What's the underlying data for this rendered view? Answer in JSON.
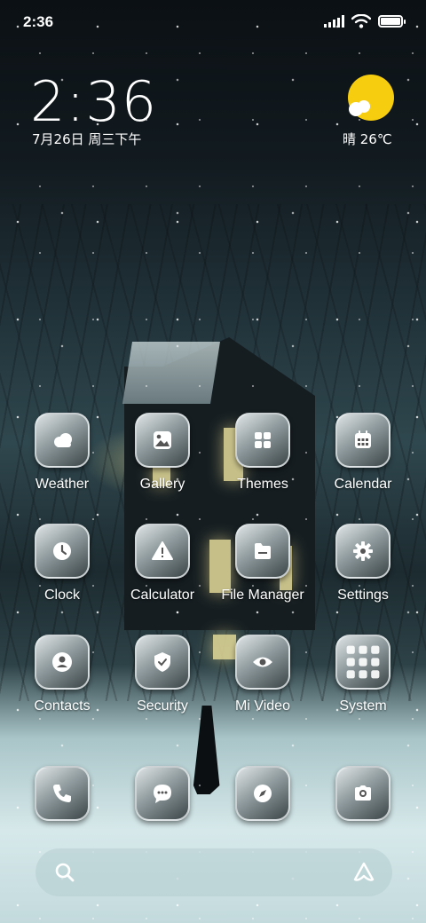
{
  "status_bar": {
    "time": "2:36",
    "icons": [
      "signal-icon",
      "wifi-icon",
      "battery-icon"
    ]
  },
  "clock_widget": {
    "time": "2:36",
    "date": "7月26日 周三下午"
  },
  "weather_widget": {
    "icon": "sun-cloud-icon",
    "text": "晴 26℃"
  },
  "apps": [
    {
      "label": "Weather",
      "icon": "weather-cloud-icon"
    },
    {
      "label": "Gallery",
      "icon": "gallery-icon"
    },
    {
      "label": "Themes",
      "icon": "themes-grid-icon"
    },
    {
      "label": "Calendar",
      "icon": "calendar-icon"
    },
    {
      "label": "Clock",
      "icon": "clock-icon"
    },
    {
      "label": "Calculator",
      "icon": "warning-triangle-icon"
    },
    {
      "label": "File Manager",
      "icon": "folder-icon"
    },
    {
      "label": "Settings",
      "icon": "gear-icon"
    },
    {
      "label": "Contacts",
      "icon": "person-icon"
    },
    {
      "label": "Security",
      "icon": "shield-icon"
    },
    {
      "label": "Mi Video",
      "icon": "eye-icon"
    },
    {
      "label": "System",
      "icon": "folder-grid-icon"
    }
  ],
  "dock": [
    {
      "icon": "phone-icon"
    },
    {
      "icon": "message-icon"
    },
    {
      "icon": "compass-icon"
    },
    {
      "icon": "camera-icon"
    }
  ],
  "search_bar": {
    "left_icon": "search-icon",
    "right_icon": "assistant-icon"
  }
}
